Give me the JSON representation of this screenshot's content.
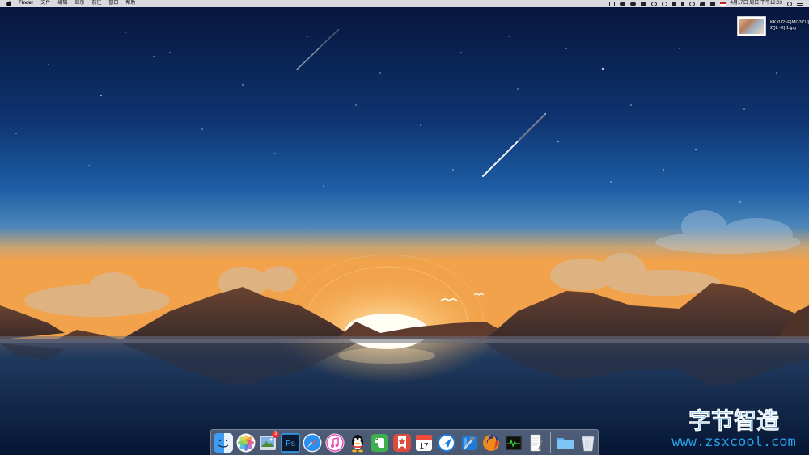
{
  "menubar": {
    "apple_icon": "apple-logo-icon",
    "app_name": "Finder",
    "menus": [
      "文件",
      "编辑",
      "显示",
      "前往",
      "窗口",
      "帮助"
    ],
    "status_icons": [
      "screen-record-icon",
      "cloud-upload-icon",
      "qq-status-icon",
      "dropbox-icon",
      "handoff-icon",
      "aperture-icon",
      "pdf-icon",
      "bluetooth-icon",
      "time-machine-icon",
      "wifi-icon",
      "volume-icon"
    ],
    "input_source_icon": "us-flag-icon",
    "clock": "4月17日 周日 下午12:33",
    "search_icon": "spotlight-icon",
    "list_icon": "notification-center-icon"
  },
  "desktop": {
    "file_name": "KKXU2~E}MG3CU}\n2(}L~E} 1.jpg"
  },
  "dock": {
    "apps": [
      {
        "name": "Finder",
        "icon": "finder-icon"
      },
      {
        "name": "Photos",
        "icon": "photos-icon"
      },
      {
        "name": "Preview",
        "icon": "preview-icon",
        "badge": "3"
      },
      {
        "name": "Photoshop",
        "icon": "photoshop-icon",
        "label": "Ps"
      },
      {
        "name": "Safari",
        "icon": "safari-icon"
      },
      {
        "name": "iTunes",
        "icon": "itunes-icon"
      },
      {
        "name": "QQ",
        "icon": "qq-icon"
      },
      {
        "name": "Evernote",
        "icon": "evernote-icon"
      },
      {
        "name": "Wunderlist",
        "icon": "wunderlist-icon"
      },
      {
        "name": "Calendar",
        "icon": "calendar-icon",
        "label": "17"
      },
      {
        "name": "Paw",
        "icon": "paw-icon"
      },
      {
        "name": "Xcode",
        "icon": "xcode-icon"
      },
      {
        "name": "Firefox",
        "icon": "firefox-icon"
      },
      {
        "name": "Activity Monitor",
        "icon": "activity-monitor-icon"
      },
      {
        "name": "TextEdit",
        "icon": "textedit-icon"
      },
      {
        "name": "Downloads",
        "icon": "folder-icon"
      },
      {
        "name": "Trash",
        "icon": "trash-icon"
      }
    ]
  },
  "watermark": {
    "title": "字节智造",
    "url": "www.zsxcool.com"
  },
  "colors": {
    "sky_top": "#08183f",
    "sky_mid": "#1f5fa4",
    "horizon": "#f0a348",
    "water": "#0d2a4f",
    "mountain": "#5e3b2e",
    "watermark": "#2aa0e8"
  }
}
